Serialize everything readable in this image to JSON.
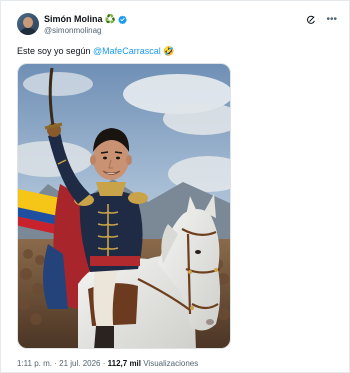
{
  "author": {
    "display_name": "Simón Molina",
    "badge_emoji": "♻️",
    "handle": "@simonmolinag"
  },
  "tweet": {
    "text_prefix": "Este soy yo según ",
    "mention": "@MafeCarrascal",
    "emoji": "🤣"
  },
  "meta": {
    "time": "1:11 p. m.",
    "separator": "·",
    "date": "21 jul. 2026",
    "views_count": "112,7 mil",
    "views_label": "Visualizaciones"
  },
  "colors": {
    "verified": "#1d9bf0",
    "mention": "#1d9bf0",
    "text": "#0f1419",
    "muted": "#536471"
  },
  "icons": {
    "verified": "verified-badge-icon",
    "grok": "grok-icon",
    "more": "more-options-icon"
  }
}
